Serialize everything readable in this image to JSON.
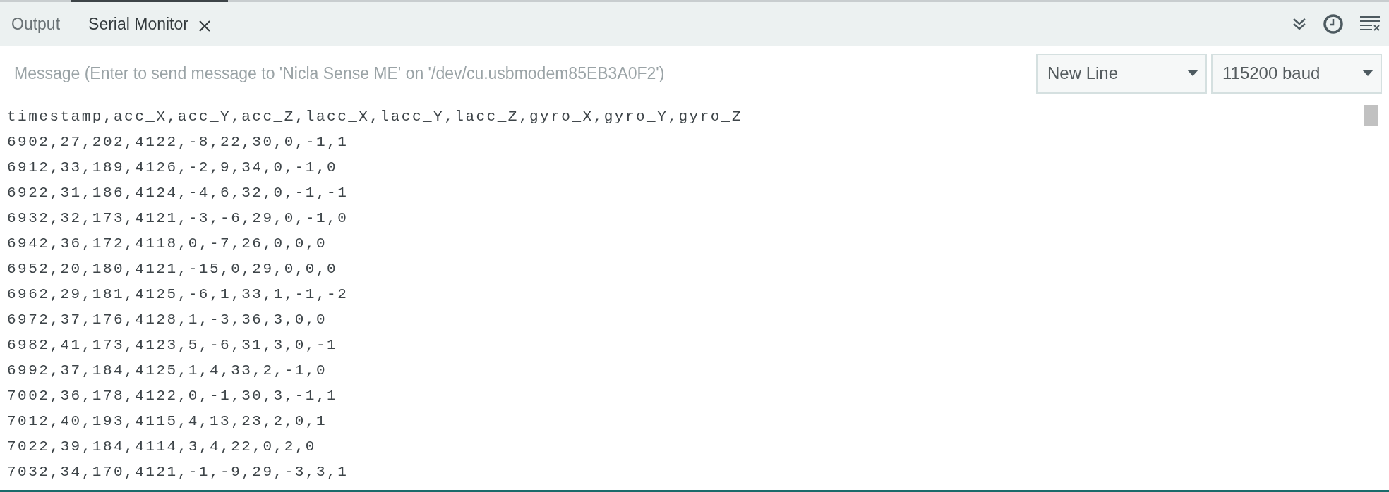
{
  "tabs": [
    {
      "label": "Output",
      "selected": false
    },
    {
      "label": "Serial Monitor",
      "selected": true
    }
  ],
  "message_field": {
    "placeholder": "Message (Enter to send message to 'Nicla Sense ME' on '/dev/cu.usbmodem85EB3A0F2')"
  },
  "dropdowns": [
    {
      "value": "New Line"
    },
    {
      "value": "115200 baud"
    }
  ],
  "output_lines": [
    "timestamp,acc_X,acc_Y,acc_Z,lacc_X,lacc_Y,lacc_Z,gyro_X,gyro_Y,gyro_Z",
    "6902,27,202,4122,-8,22,30,0,-1,1",
    "6912,33,189,4126,-2,9,34,0,-1,0",
    "6922,31,186,4124,-4,6,32,0,-1,-1",
    "6932,32,173,4121,-3,-6,29,0,-1,0",
    "6942,36,172,4118,0,-7,26,0,0,0",
    "6952,20,180,4121,-15,0,29,0,0,0",
    "6962,29,181,4125,-6,1,33,1,-1,-2",
    "6972,37,176,4128,1,-3,36,3,0,0",
    "6982,41,173,4123,5,-6,31,3,0,-1",
    "6992,37,184,4125,1,4,33,2,-1,0",
    "7002,36,178,4122,0,-1,30,3,-1,1",
    "7012,40,193,4115,4,13,23,2,0,1",
    "7022,39,184,4114,3,4,22,0,2,0",
    "7032,34,170,4121,-1,-9,29,-3,3,1"
  ]
}
